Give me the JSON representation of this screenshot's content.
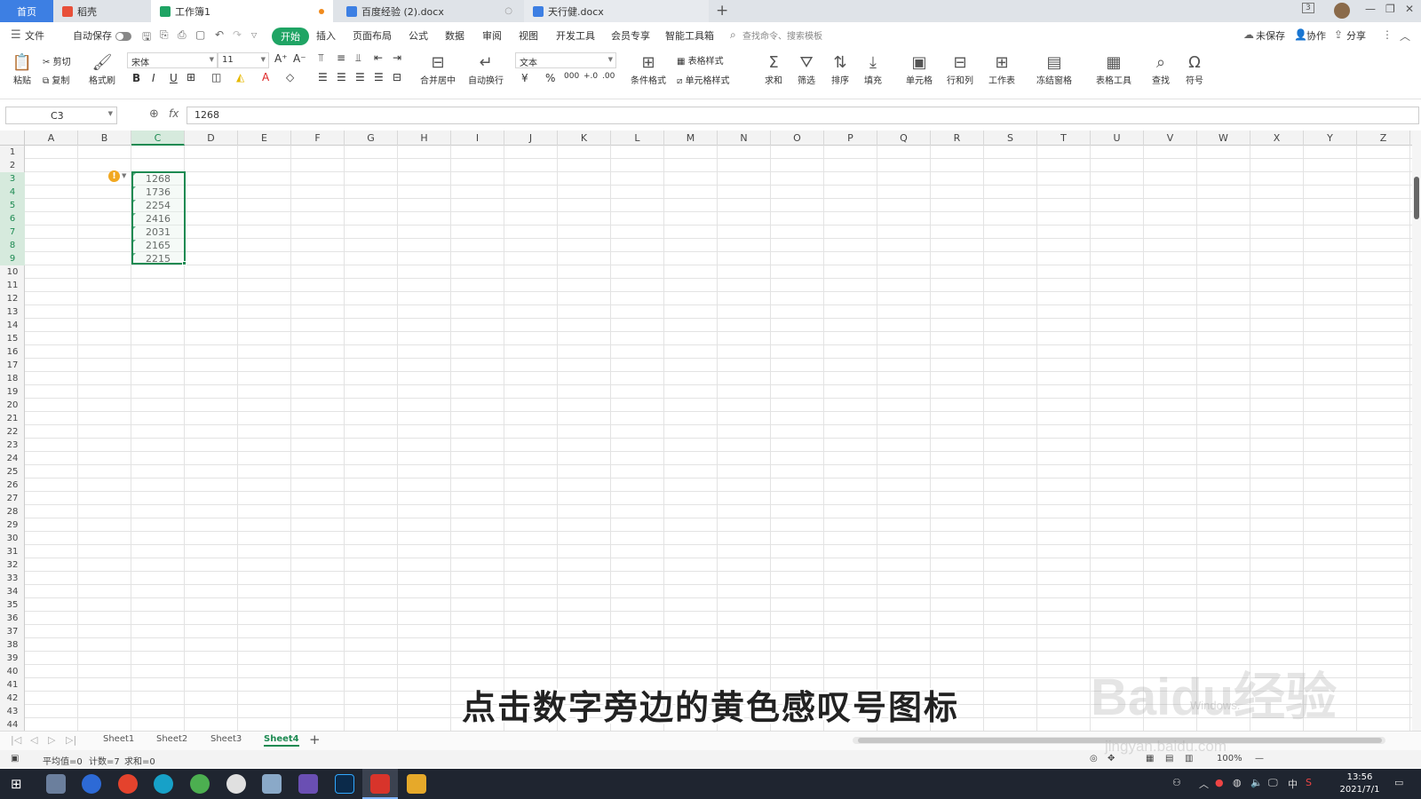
{
  "titlebar": {
    "tabs": [
      {
        "label": "首页"
      },
      {
        "label": "稻壳"
      },
      {
        "label": "工作簿1"
      },
      {
        "label": "百度经验 (2).docx"
      },
      {
        "label": "天行健.docx"
      }
    ],
    "new_tab": "+",
    "window_badge": "3"
  },
  "menu": {
    "file": "文件",
    "autosave": "自动保存",
    "items": [
      "开始",
      "插入",
      "页面布局",
      "公式",
      "数据",
      "审阅",
      "视图",
      "开发工具",
      "会员专享",
      "智能工具箱"
    ],
    "search_placeholder": "查找命令、搜索模板",
    "right": {
      "unsaved": "未保存",
      "collab": "协作",
      "share": "分享"
    }
  },
  "ribbon": {
    "paste": "粘贴",
    "cut": "剪切",
    "copy": "复制",
    "format_painter": "格式刷",
    "font_name": "宋体",
    "font_size": "11",
    "merge_center": "合并居中",
    "auto_wrap": "自动换行",
    "number_format": "文本",
    "conditional_format": "条件格式",
    "table_style": "表格样式",
    "cell_style": "单元格样式",
    "sum": "求和",
    "filter": "筛选",
    "sort": "排序",
    "fill": "填充",
    "cells": "单元格",
    "rows_cols": "行和列",
    "worksheet": "工作表",
    "freeze": "冻结窗格",
    "table_tools": "表格工具",
    "find": "查找",
    "symbol": "符号"
  },
  "formula_bar": {
    "name_box": "C3",
    "fx": "fx",
    "value": "1268"
  },
  "grid": {
    "columns": [
      "A",
      "B",
      "C",
      "D",
      "E",
      "F",
      "G",
      "H",
      "I",
      "J",
      "K",
      "L",
      "M",
      "N",
      "O",
      "P",
      "Q",
      "R",
      "S",
      "T",
      "U",
      "V",
      "W",
      "X",
      "Y",
      "Z"
    ],
    "selected_column": "C",
    "rows_visible": 44,
    "selected_rows": [
      3,
      4,
      5,
      6,
      7,
      8,
      9
    ],
    "cell_values": [
      "1268",
      "1736",
      "2254",
      "2416",
      "2031",
      "2165",
      "2215"
    ],
    "warning_icon": "!"
  },
  "sheets": {
    "tabs": [
      "Sheet1",
      "Sheet2",
      "Sheet3",
      "Sheet4"
    ],
    "active": "Sheet4",
    "add": "+"
  },
  "status": {
    "average": "平均值=0",
    "count": "计数=7",
    "sum": "求和=0",
    "zoom": "100%"
  },
  "taskbar": {
    "time": "13:56",
    "date": "2021/7/1",
    "ime": "中"
  },
  "overlay": {
    "subtitle": "点击数字旁边的黄色感叹号图标",
    "watermark": "Baidu经验",
    "watermark_url": "jingyan.baidu.com",
    "watermark_win": "Windows."
  }
}
